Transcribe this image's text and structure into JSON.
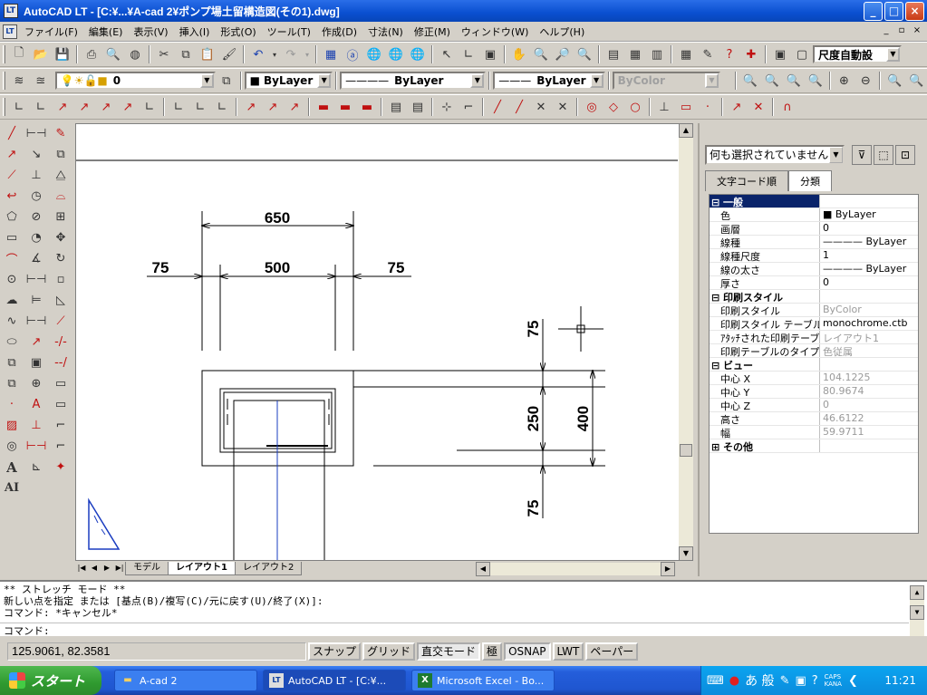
{
  "window": {
    "app_icon": "LT",
    "title": "AutoCAD LT - [C:¥...¥A-cad 2¥ポンプ場土留構造図(その1).dwg]",
    "buttons": [
      "_",
      "□",
      "×"
    ]
  },
  "menu": {
    "items": [
      "ファイル(F)",
      "編集(E)",
      "表示(V)",
      "挿入(I)",
      "形式(O)",
      "ツール(T)",
      "作成(D)",
      "寸法(N)",
      "修正(M)",
      "ウィンドウ(W)",
      "ヘルプ(H)"
    ],
    "mdi_buttons": [
      "_",
      "▫",
      "×"
    ]
  },
  "toolbar_standard": {
    "dim_style_value": "尺度自動設"
  },
  "layer_toolbar": {
    "layer_value": "0",
    "color_value": "ByLayer",
    "linetype_value": "ByLayer",
    "lineweight_value": "ByLayer",
    "plotstyle_value": "ByColor"
  },
  "drawing": {
    "dimensions": [
      "650",
      "75",
      "500",
      "75",
      "75",
      "250",
      "400",
      "75"
    ]
  },
  "layout_tabs": [
    "モデル",
    "レイアウト1",
    "レイアウト2"
  ],
  "properties": {
    "selection": "何も選択されていません",
    "tabs": [
      "文字コード順",
      "分類"
    ],
    "rows": [
      {
        "key": "一般",
        "value": "",
        "type": "cat"
      },
      {
        "key": "色",
        "value": "■ ByLayer"
      },
      {
        "key": "画層",
        "value": "0"
      },
      {
        "key": "線種",
        "value": "———— ByLayer"
      },
      {
        "key": "線種尺度",
        "value": "1"
      },
      {
        "key": "線の太さ",
        "value": "———— ByLayer"
      },
      {
        "key": "厚さ",
        "value": "0"
      },
      {
        "key": "印刷スタイル",
        "value": "",
        "type": "cat"
      },
      {
        "key": "印刷スタイル",
        "value": "ByColor",
        "dim": true
      },
      {
        "key": "印刷スタイル テーブル",
        "value": "monochrome.ctb"
      },
      {
        "key": "ｱﾀｯﾁされた印刷テーブ",
        "value": "レイアウト1",
        "dim": true
      },
      {
        "key": "印刷テーブルのタイプ",
        "value": "色従属",
        "dim": true
      },
      {
        "key": "ビュー",
        "value": "",
        "type": "cat"
      },
      {
        "key": "中心 X",
        "value": "104.1225",
        "dim": true
      },
      {
        "key": "中心 Y",
        "value": "80.9674",
        "dim": true
      },
      {
        "key": "中心 Z",
        "value": "0",
        "dim": true
      },
      {
        "key": "高さ",
        "value": "46.6122",
        "dim": true
      },
      {
        "key": "幅",
        "value": "59.9711",
        "dim": true
      },
      {
        "key": "その他",
        "value": "",
        "type": "cat"
      }
    ]
  },
  "command": {
    "lines": [
      "** ストレッチ モード **",
      "新しい点を指定 または [基点(B)/複写(C)/元に戻す(U)/終了(X)]:",
      "コマンド: *キャンセル*"
    ],
    "prompt": "コマンド:"
  },
  "status": {
    "coords": "125.9061, 82.3581",
    "modes": [
      {
        "label": "スナップ",
        "on": false
      },
      {
        "label": "グリッド",
        "on": false
      },
      {
        "label": "直交モード",
        "on": true
      },
      {
        "label": "極",
        "on": false
      },
      {
        "label": "OSNAP",
        "on": true
      },
      {
        "label": "LWT",
        "on": false
      },
      {
        "label": "ペーパー",
        "on": false
      }
    ]
  },
  "taskbar": {
    "start": "スタート",
    "tasks": [
      {
        "label": "A-cad 2",
        "icon": "folder-icon"
      },
      {
        "label": "AutoCAD LT - [C:¥...",
        "icon": "autocad-icon"
      },
      {
        "label": "Microsoft Excel - Bo...",
        "icon": "excel-icon"
      }
    ],
    "ime": "あ 般",
    "caps": "CAPS",
    "kana": "KANA",
    "clock": "11:21"
  }
}
